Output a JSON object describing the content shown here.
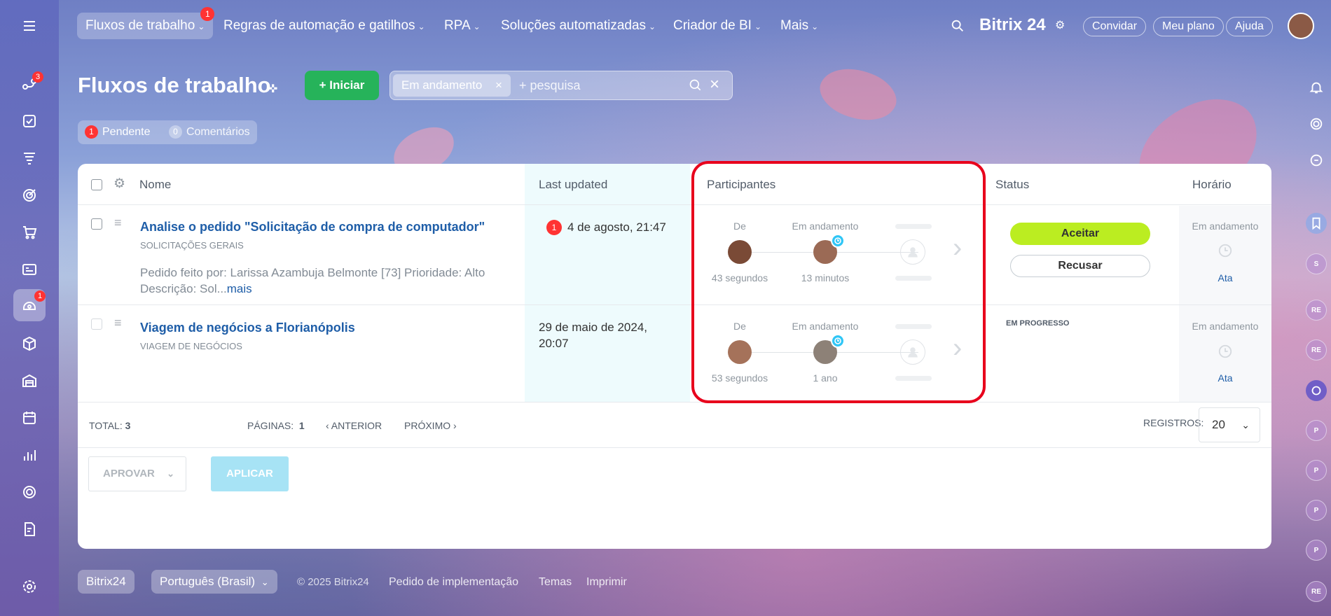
{
  "topnav": {
    "items": [
      {
        "label": "Fluxos de trabalho",
        "badge": "1"
      },
      {
        "label": "Regras de automação e gatilhos"
      },
      {
        "label": "RPA"
      },
      {
        "label": "Soluções automatizadas"
      },
      {
        "label": "Criador de BI"
      },
      {
        "label": "Mais"
      }
    ],
    "brand": "Bitrix 24",
    "invite": "Convidar",
    "plan": "Meu plano",
    "help": "Ajuda"
  },
  "leftbar": {
    "items": [
      {
        "icon": "menu-icon"
      },
      {
        "icon": "flows-icon",
        "badge": "3"
      },
      {
        "icon": "tasks-icon"
      },
      {
        "icon": "funnel-icon"
      },
      {
        "icon": "target-icon"
      },
      {
        "icon": "cart-icon"
      },
      {
        "icon": "contact-card-icon"
      },
      {
        "icon": "automation-icon",
        "badge": "1"
      },
      {
        "icon": "box-icon"
      },
      {
        "icon": "warehouse-icon"
      },
      {
        "icon": "calendar-icon"
      },
      {
        "icon": "chart-icon"
      },
      {
        "icon": "lifebuoy-icon"
      },
      {
        "icon": "edit-doc-icon"
      },
      {
        "icon": "settings-icon"
      }
    ]
  },
  "rightbar": {
    "avatars": [
      "S",
      "RE",
      "RE",
      "P",
      "P",
      "P",
      "P",
      "RE"
    ]
  },
  "page": {
    "title": "Fluxos de trabalho",
    "start_button": "Iniciar",
    "filter_chip": "Em andamento",
    "search_placeholder": "+ pesquisa",
    "pending_count": "1",
    "pending_label": "Pendente",
    "comments_count": "0",
    "comments_label": "Comentários"
  },
  "table": {
    "headers": {
      "name": "Nome",
      "updated": "Last updated",
      "participants": "Participantes",
      "status": "Status",
      "time": "Horário"
    },
    "rows": [
      {
        "title": "Analise o pedido \"Solicitação de compra de computador\"",
        "category": "SOLICITAÇÕES GERAIS",
        "desc": "Pedido feito por: Larissa Azambuja Belmonte [73] Prioridade: Alto Descrição: Sol...",
        "more": "mais",
        "updated_badge": "1",
        "updated": "4 de agosto, 21:47",
        "from_label": "De",
        "from_time": "43 segundos",
        "progress_label": "Em andamento",
        "progress_time": "13 minutos",
        "accept": "Aceitar",
        "decline": "Recusar",
        "time_label": "Em andamento",
        "time_link": "Ata"
      },
      {
        "title": "Viagem de negócios a Florianópolis",
        "category": "VIAGEM DE NEGÓCIOS",
        "updated_line1": "29 de maio de 2024,",
        "updated_line2": "20:07",
        "from_label": "De",
        "from_time": "53 segundos",
        "progress_label": "Em andamento",
        "progress_time": "1 ano",
        "status": "EM PROGRESSO",
        "time_label": "Em andamento",
        "time_link": "Ata"
      }
    ],
    "footer": {
      "total_label": "TOTAL:",
      "total_value": "3",
      "pages_label": "PÁGINAS:",
      "pages_value": "1",
      "prev": "ANTERIOR",
      "next": "PRÓXIMO",
      "records_label": "REGISTROS:",
      "records_value": "20",
      "approve": "APROVAR",
      "apply": "APLICAR"
    }
  },
  "footer": {
    "brand": "Bitrix24",
    "language": "Português (Brasil)",
    "copyright": "© 2025 Bitrix24",
    "link_impl": "Pedido de implementação",
    "link_themes": "Temas",
    "link_print": "Imprimir"
  },
  "colors": {
    "accent": "#26b35a",
    "link": "#1f5ea8",
    "highlight": "#e8001c",
    "accept": "#bbed21"
  }
}
